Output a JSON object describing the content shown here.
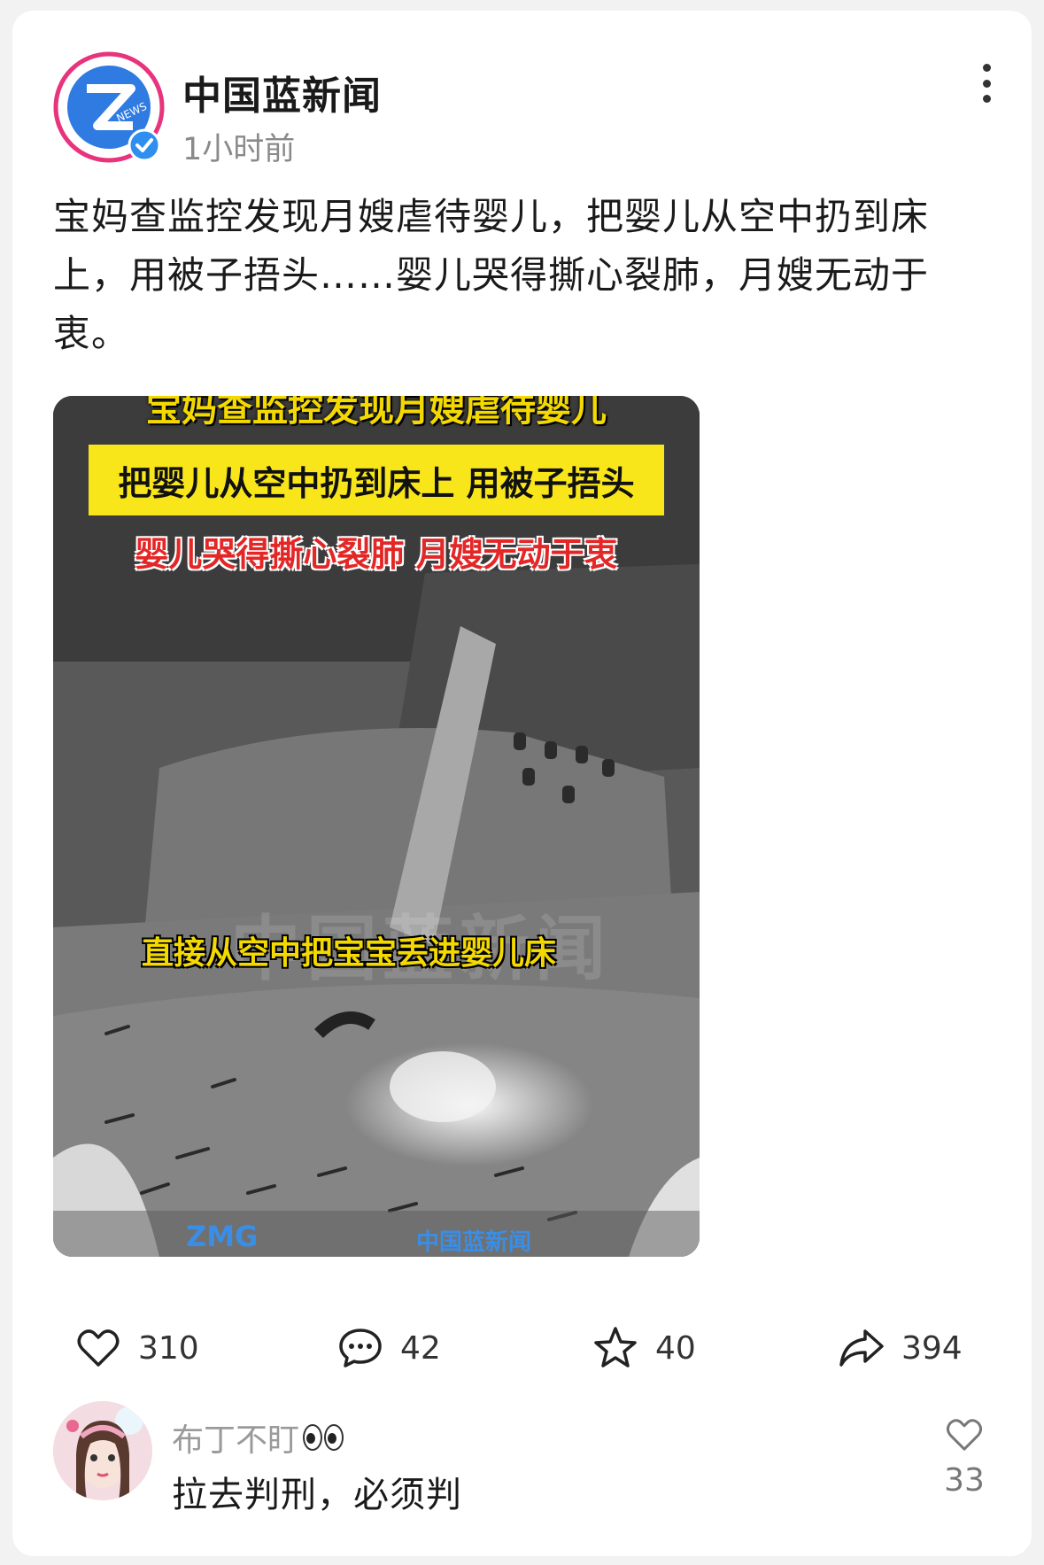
{
  "post": {
    "author": "中国蓝新闻",
    "time": "1小时前",
    "text": "宝妈查监控发现月嫂虐待婴儿，把婴儿从空中扔到床上，用被子捂头……婴儿哭得撕心裂肺，月嫂无动于衷。",
    "avatar_icon": "zjtv-news-logo",
    "verified_icon": "verified-check-icon",
    "more_icon": "more-vertical-icon"
  },
  "media": {
    "caption_top": "宝妈查监控发现月嫂虐待婴儿",
    "caption_yellow": "把婴儿从空中扔到床上 用被子捂头",
    "caption_red": "婴儿哭得撕心裂肺 月嫂无动于衷",
    "caption_mid": "直接从空中把宝宝丢进婴儿床",
    "watermark": "中国蓝新闻",
    "logo_left": "ZMG",
    "logo_right": "中国蓝新闻"
  },
  "actions": {
    "likes": "310",
    "comments": "42",
    "favorites": "40",
    "shares": "394"
  },
  "top_comment": {
    "user": "布丁不盯",
    "text": "拉去判刑，必须判",
    "likes": "33"
  },
  "colors": {
    "logo_pink": "#e8337d",
    "logo_blue": "#2f7be2",
    "caption_yellow": "#f8e61b",
    "caption_red": "#e32727"
  }
}
